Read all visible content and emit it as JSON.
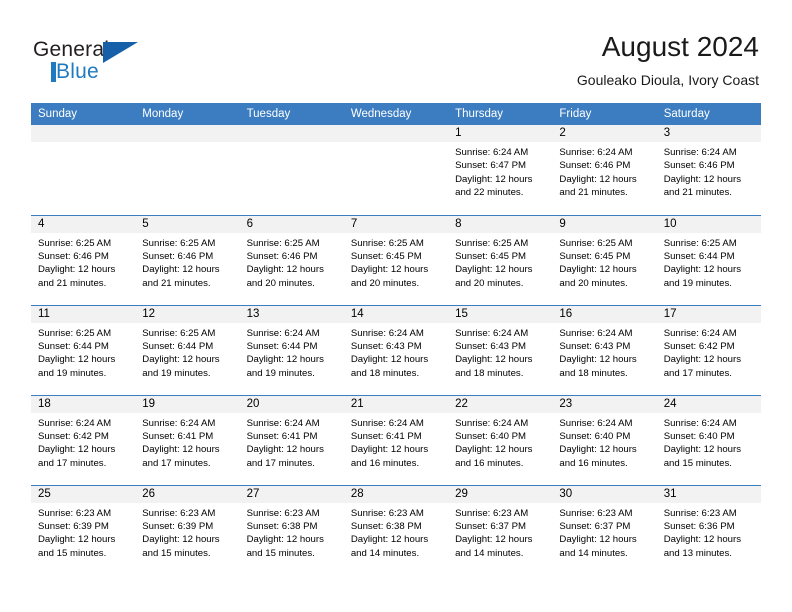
{
  "brand": {
    "name_part1": "General",
    "name_part2": "Blue",
    "logo_icon": "triangle-flag-icon"
  },
  "header": {
    "title": "August 2024",
    "subtitle": "Gouleako Dioula, Ivory Coast"
  },
  "calendar": {
    "accent_color": "#3b7dc0",
    "daynum_bg": "#f2f2f2",
    "weekday_headers": [
      "Sunday",
      "Monday",
      "Tuesday",
      "Wednesday",
      "Thursday",
      "Friday",
      "Saturday"
    ],
    "weeks": [
      [
        {
          "day": "",
          "sunrise": "",
          "sunset": "",
          "daylight_line1": "",
          "daylight_line2": ""
        },
        {
          "day": "",
          "sunrise": "",
          "sunset": "",
          "daylight_line1": "",
          "daylight_line2": ""
        },
        {
          "day": "",
          "sunrise": "",
          "sunset": "",
          "daylight_line1": "",
          "daylight_line2": ""
        },
        {
          "day": "",
          "sunrise": "",
          "sunset": "",
          "daylight_line1": "",
          "daylight_line2": ""
        },
        {
          "day": "1",
          "sunrise": "Sunrise: 6:24 AM",
          "sunset": "Sunset: 6:47 PM",
          "daylight_line1": "Daylight: 12 hours",
          "daylight_line2": "and 22 minutes."
        },
        {
          "day": "2",
          "sunrise": "Sunrise: 6:24 AM",
          "sunset": "Sunset: 6:46 PM",
          "daylight_line1": "Daylight: 12 hours",
          "daylight_line2": "and 21 minutes."
        },
        {
          "day": "3",
          "sunrise": "Sunrise: 6:24 AM",
          "sunset": "Sunset: 6:46 PM",
          "daylight_line1": "Daylight: 12 hours",
          "daylight_line2": "and 21 minutes."
        }
      ],
      [
        {
          "day": "4",
          "sunrise": "Sunrise: 6:25 AM",
          "sunset": "Sunset: 6:46 PM",
          "daylight_line1": "Daylight: 12 hours",
          "daylight_line2": "and 21 minutes."
        },
        {
          "day": "5",
          "sunrise": "Sunrise: 6:25 AM",
          "sunset": "Sunset: 6:46 PM",
          "daylight_line1": "Daylight: 12 hours",
          "daylight_line2": "and 21 minutes."
        },
        {
          "day": "6",
          "sunrise": "Sunrise: 6:25 AM",
          "sunset": "Sunset: 6:46 PM",
          "daylight_line1": "Daylight: 12 hours",
          "daylight_line2": "and 20 minutes."
        },
        {
          "day": "7",
          "sunrise": "Sunrise: 6:25 AM",
          "sunset": "Sunset: 6:45 PM",
          "daylight_line1": "Daylight: 12 hours",
          "daylight_line2": "and 20 minutes."
        },
        {
          "day": "8",
          "sunrise": "Sunrise: 6:25 AM",
          "sunset": "Sunset: 6:45 PM",
          "daylight_line1": "Daylight: 12 hours",
          "daylight_line2": "and 20 minutes."
        },
        {
          "day": "9",
          "sunrise": "Sunrise: 6:25 AM",
          "sunset": "Sunset: 6:45 PM",
          "daylight_line1": "Daylight: 12 hours",
          "daylight_line2": "and 20 minutes."
        },
        {
          "day": "10",
          "sunrise": "Sunrise: 6:25 AM",
          "sunset": "Sunset: 6:44 PM",
          "daylight_line1": "Daylight: 12 hours",
          "daylight_line2": "and 19 minutes."
        }
      ],
      [
        {
          "day": "11",
          "sunrise": "Sunrise: 6:25 AM",
          "sunset": "Sunset: 6:44 PM",
          "daylight_line1": "Daylight: 12 hours",
          "daylight_line2": "and 19 minutes."
        },
        {
          "day": "12",
          "sunrise": "Sunrise: 6:25 AM",
          "sunset": "Sunset: 6:44 PM",
          "daylight_line1": "Daylight: 12 hours",
          "daylight_line2": "and 19 minutes."
        },
        {
          "day": "13",
          "sunrise": "Sunrise: 6:24 AM",
          "sunset": "Sunset: 6:44 PM",
          "daylight_line1": "Daylight: 12 hours",
          "daylight_line2": "and 19 minutes."
        },
        {
          "day": "14",
          "sunrise": "Sunrise: 6:24 AM",
          "sunset": "Sunset: 6:43 PM",
          "daylight_line1": "Daylight: 12 hours",
          "daylight_line2": "and 18 minutes."
        },
        {
          "day": "15",
          "sunrise": "Sunrise: 6:24 AM",
          "sunset": "Sunset: 6:43 PM",
          "daylight_line1": "Daylight: 12 hours",
          "daylight_line2": "and 18 minutes."
        },
        {
          "day": "16",
          "sunrise": "Sunrise: 6:24 AM",
          "sunset": "Sunset: 6:43 PM",
          "daylight_line1": "Daylight: 12 hours",
          "daylight_line2": "and 18 minutes."
        },
        {
          "day": "17",
          "sunrise": "Sunrise: 6:24 AM",
          "sunset": "Sunset: 6:42 PM",
          "daylight_line1": "Daylight: 12 hours",
          "daylight_line2": "and 17 minutes."
        }
      ],
      [
        {
          "day": "18",
          "sunrise": "Sunrise: 6:24 AM",
          "sunset": "Sunset: 6:42 PM",
          "daylight_line1": "Daylight: 12 hours",
          "daylight_line2": "and 17 minutes."
        },
        {
          "day": "19",
          "sunrise": "Sunrise: 6:24 AM",
          "sunset": "Sunset: 6:41 PM",
          "daylight_line1": "Daylight: 12 hours",
          "daylight_line2": "and 17 minutes."
        },
        {
          "day": "20",
          "sunrise": "Sunrise: 6:24 AM",
          "sunset": "Sunset: 6:41 PM",
          "daylight_line1": "Daylight: 12 hours",
          "daylight_line2": "and 17 minutes."
        },
        {
          "day": "21",
          "sunrise": "Sunrise: 6:24 AM",
          "sunset": "Sunset: 6:41 PM",
          "daylight_line1": "Daylight: 12 hours",
          "daylight_line2": "and 16 minutes."
        },
        {
          "day": "22",
          "sunrise": "Sunrise: 6:24 AM",
          "sunset": "Sunset: 6:40 PM",
          "daylight_line1": "Daylight: 12 hours",
          "daylight_line2": "and 16 minutes."
        },
        {
          "day": "23",
          "sunrise": "Sunrise: 6:24 AM",
          "sunset": "Sunset: 6:40 PM",
          "daylight_line1": "Daylight: 12 hours",
          "daylight_line2": "and 16 minutes."
        },
        {
          "day": "24",
          "sunrise": "Sunrise: 6:24 AM",
          "sunset": "Sunset: 6:40 PM",
          "daylight_line1": "Daylight: 12 hours",
          "daylight_line2": "and 15 minutes."
        }
      ],
      [
        {
          "day": "25",
          "sunrise": "Sunrise: 6:23 AM",
          "sunset": "Sunset: 6:39 PM",
          "daylight_line1": "Daylight: 12 hours",
          "daylight_line2": "and 15 minutes."
        },
        {
          "day": "26",
          "sunrise": "Sunrise: 6:23 AM",
          "sunset": "Sunset: 6:39 PM",
          "daylight_line1": "Daylight: 12 hours",
          "daylight_line2": "and 15 minutes."
        },
        {
          "day": "27",
          "sunrise": "Sunrise: 6:23 AM",
          "sunset": "Sunset: 6:38 PM",
          "daylight_line1": "Daylight: 12 hours",
          "daylight_line2": "and 15 minutes."
        },
        {
          "day": "28",
          "sunrise": "Sunrise: 6:23 AM",
          "sunset": "Sunset: 6:38 PM",
          "daylight_line1": "Daylight: 12 hours",
          "daylight_line2": "and 14 minutes."
        },
        {
          "day": "29",
          "sunrise": "Sunrise: 6:23 AM",
          "sunset": "Sunset: 6:37 PM",
          "daylight_line1": "Daylight: 12 hours",
          "daylight_line2": "and 14 minutes."
        },
        {
          "day": "30",
          "sunrise": "Sunrise: 6:23 AM",
          "sunset": "Sunset: 6:37 PM",
          "daylight_line1": "Daylight: 12 hours",
          "daylight_line2": "and 14 minutes."
        },
        {
          "day": "31",
          "sunrise": "Sunrise: 6:23 AM",
          "sunset": "Sunset: 6:36 PM",
          "daylight_line1": "Daylight: 12 hours",
          "daylight_line2": "and 13 minutes."
        }
      ]
    ]
  }
}
